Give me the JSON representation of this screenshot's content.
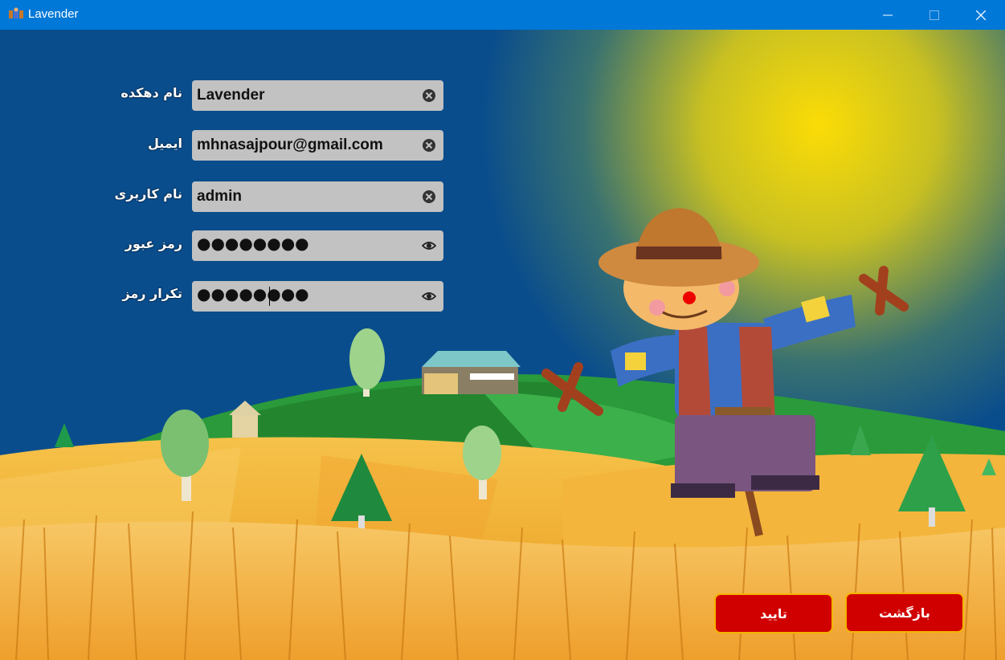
{
  "window": {
    "title": "Lavender",
    "icon": "app-icon",
    "controls": [
      "minimize-icon",
      "maximize-icon",
      "close-icon"
    ]
  },
  "form": {
    "village_name": {
      "label": "نام دهکده",
      "value": "Lavender",
      "icon": "clear-icon"
    },
    "email": {
      "label": "ایمیل",
      "value": "mhnasajpour@gmail.com",
      "icon": "clear-icon"
    },
    "username": {
      "label": "نام کاربری",
      "value": "admin",
      "icon": "clear-icon"
    },
    "password": {
      "label": "رمز عبور",
      "value": "●●●●●●●●",
      "icon": "eye-icon"
    },
    "confirm_password": {
      "label": "تکرار رمز",
      "value": "●●●●●●●●",
      "icon": "eye-icon"
    }
  },
  "buttons": {
    "back": "بازگشت",
    "confirm": "تایید"
  },
  "colors": {
    "titlebar": "#0078d7",
    "sky": "#0a4d8c",
    "sun": "#f5d90a",
    "field_bg": "#c2c2c2",
    "button_bg": "#d10000",
    "button_border": "#f5b400"
  }
}
